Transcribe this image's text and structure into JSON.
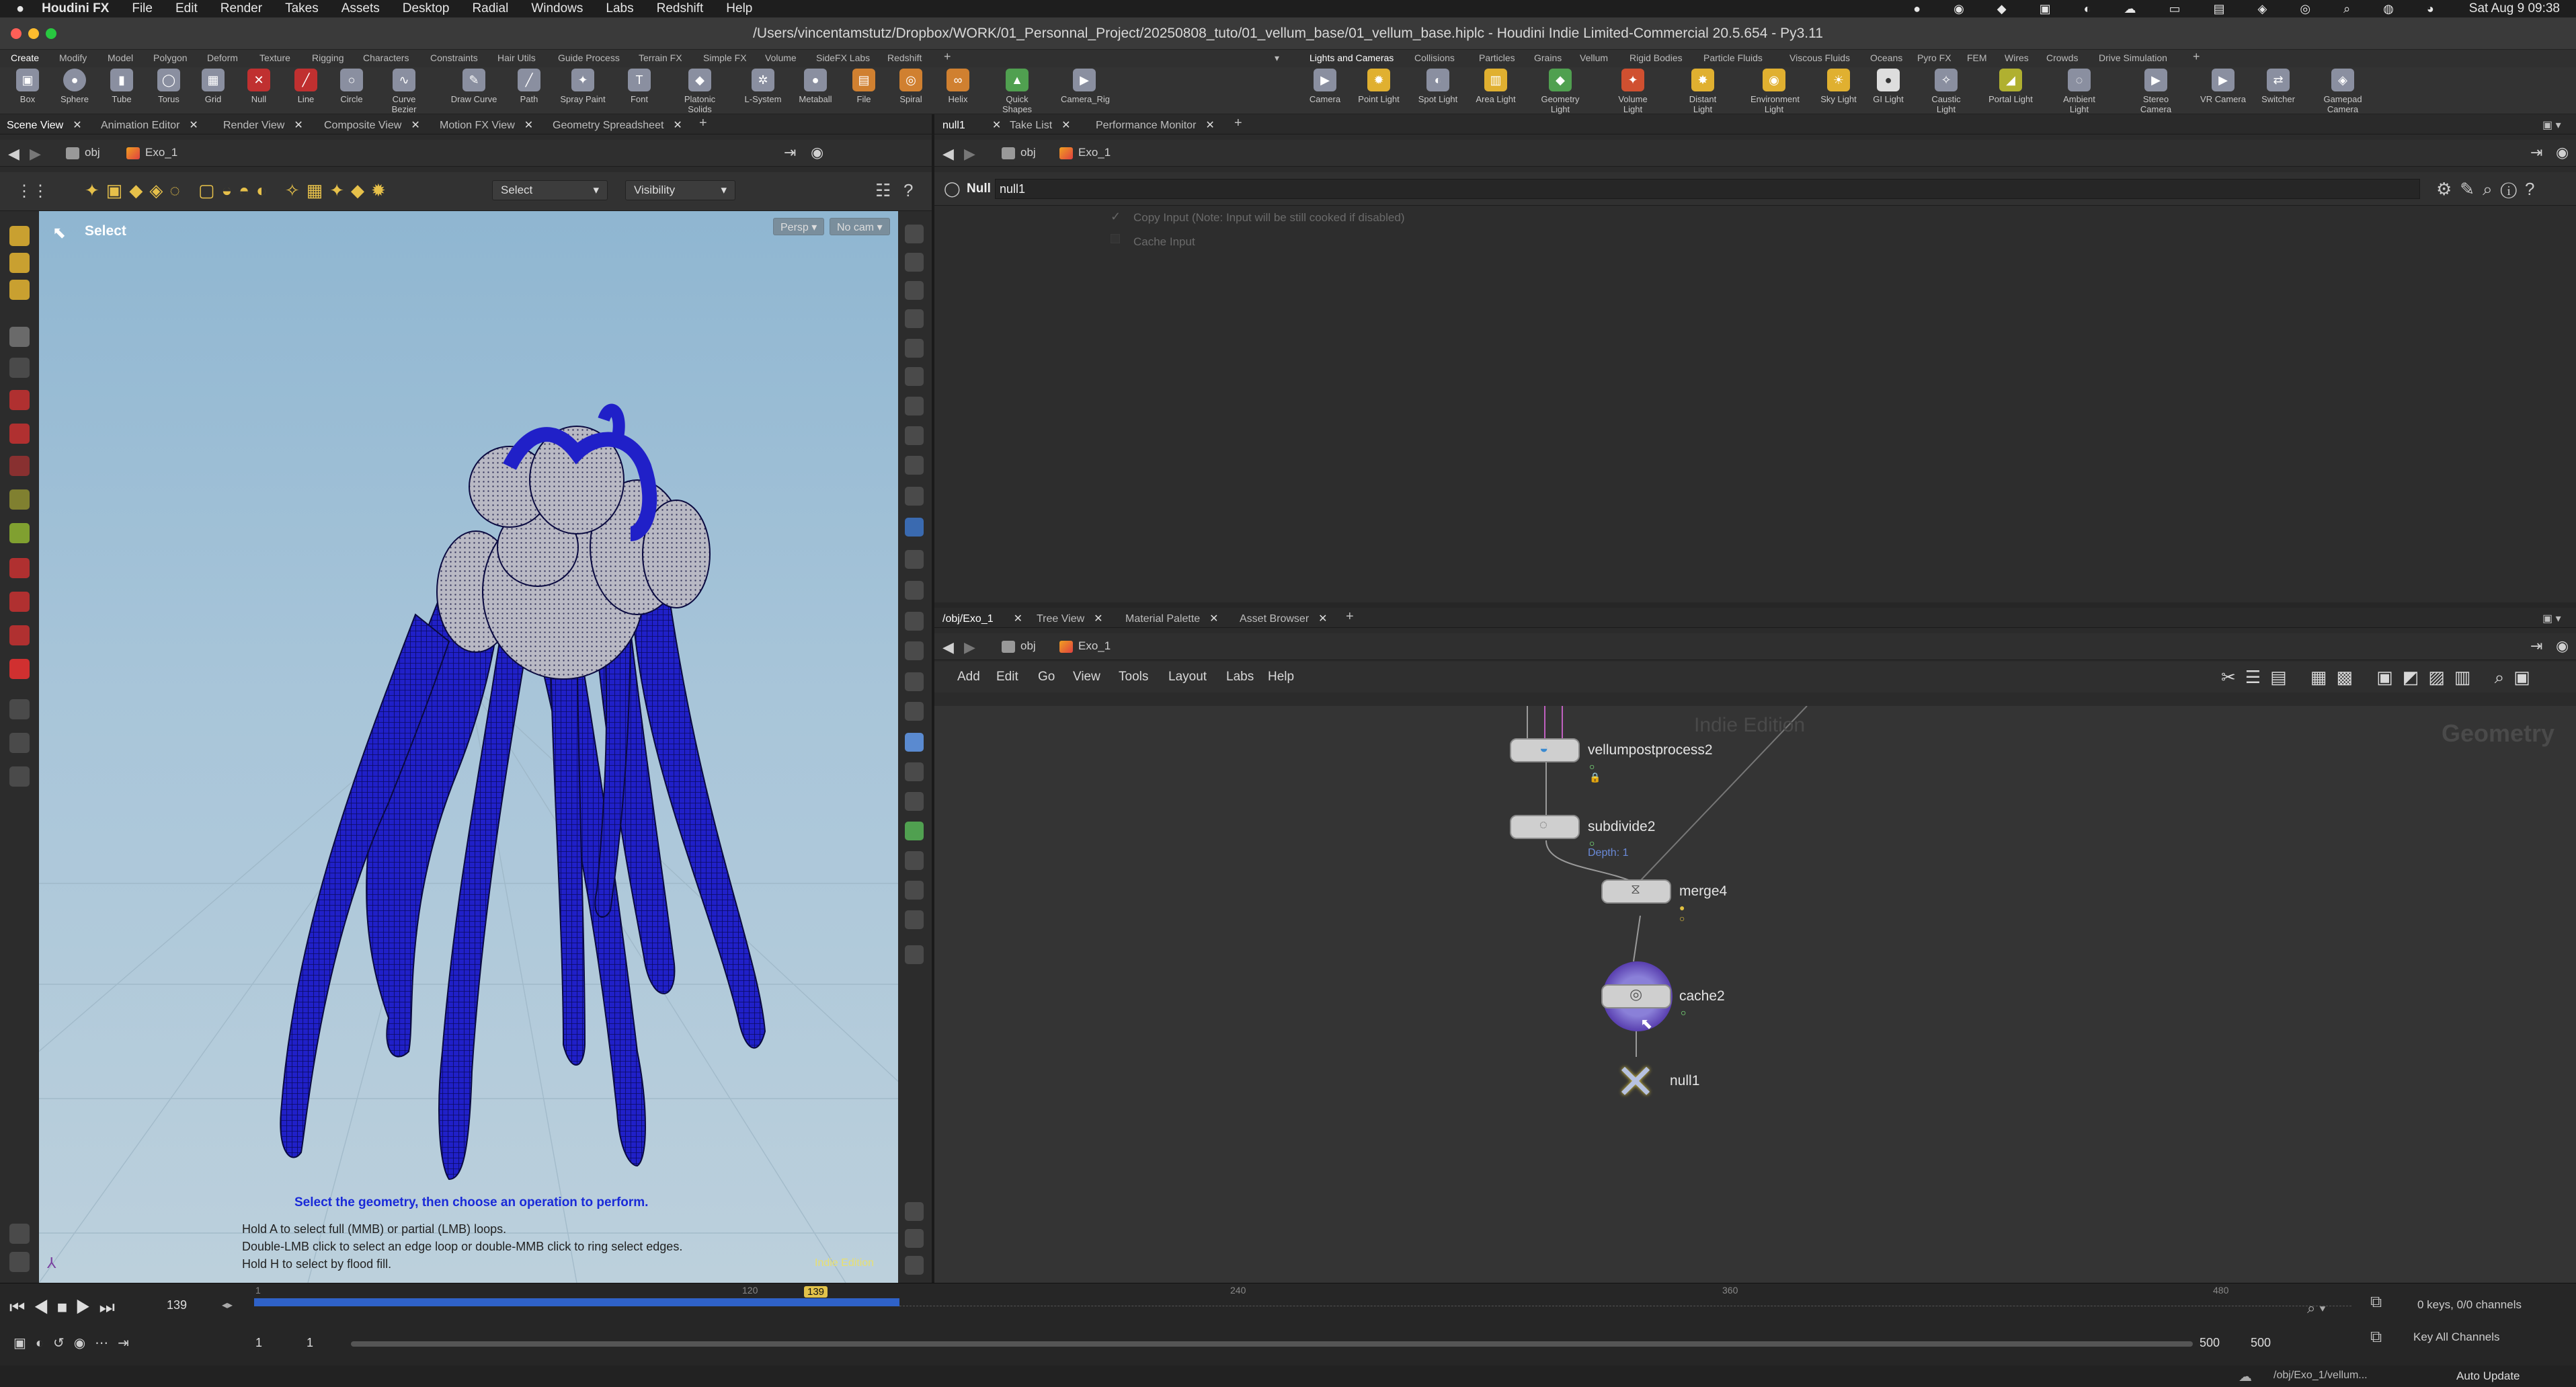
{
  "menubar": {
    "app": "Houdini FX",
    "items": [
      "File",
      "Edit",
      "Render",
      "Takes",
      "Assets",
      "Desktop",
      "Radial",
      "Windows",
      "Labs",
      "Redshift",
      "Help"
    ],
    "clock": "Sat Aug 9  09:38"
  },
  "window": {
    "title": "/Users/vincentamstutz/Dropbox/WORK/01_Personnal_Project/20250808_tuto/01_vellum_base/01_vellum_base.hiplc - Houdini Indie Limited-Commercial 20.5.654 - Py3.11"
  },
  "shelf_tabs_left": [
    "Create",
    "Modify",
    "Model",
    "Polygon",
    "Deform",
    "Texture",
    "Rigging",
    "Characters",
    "Constraints",
    "Hair Utils",
    "Guide Process",
    "Terrain FX",
    "Simple FX",
    "Volume",
    "SideFX Labs",
    "Redshift"
  ],
  "shelf_tabs_right": [
    "Lights and Cameras",
    "Collisions",
    "Particles",
    "Grains",
    "Vellum",
    "Rigid Bodies",
    "Particle Fluids",
    "Viscous Fluids",
    "Oceans",
    "Pyro FX",
    "FEM",
    "Wires",
    "Crowds",
    "Drive Simulation"
  ],
  "shelf_tools_left": [
    "Box",
    "Sphere",
    "Tube",
    "Torus",
    "Grid",
    "Null",
    "Line",
    "Circle",
    "Curve Bezier",
    "Draw Curve",
    "Path",
    "Spray Paint",
    "Font",
    "Platonic Solids",
    "L-System",
    "Metaball",
    "File",
    "Spiral",
    "Helix",
    "Quick Shapes",
    "Camera_Rig"
  ],
  "shelf_tools_right": [
    "Camera",
    "Point Light",
    "Spot Light",
    "Area Light",
    "Geometry Light",
    "Volume Light",
    "Distant Light",
    "Environment Light",
    "Sky Light",
    "GI Light",
    "Caustic Light",
    "Portal Light",
    "Ambient Light",
    "Stereo Camera",
    "VR Camera",
    "Switcher",
    "Gamepad Camera"
  ],
  "left_pane_tabs": [
    "Scene View",
    "Animation Editor",
    "Render View",
    "Composite View",
    "Motion FX View",
    "Geometry Spreadsheet"
  ],
  "top_right_tabs": [
    "null1",
    "Take List",
    "Performance Monitor"
  ],
  "path": {
    "obj": "obj",
    "geo": "Exo_1"
  },
  "viewport": {
    "select_dropdown": "Select",
    "visibility_dropdown": "Visibility",
    "select_label": "Select",
    "persp": "Persp",
    "cam": "No cam",
    "hint_main": "Select the geometry, then choose an operation to perform.",
    "hint_lines": [
      "Hold A to select full (MMB) or partial (LMB) loops.",
      "Double-LMB click to select an edge loop or double-MMB click to ring select edges.",
      "Hold H to select by flood fill."
    ],
    "watermark": "Indie Edition",
    "wire_color": "#1a1ad0"
  },
  "params": {
    "type": "Null",
    "name": "null1",
    "copy_input": "Copy Input (Note: Input will be still cooked if disabled)",
    "cache_input": "Cache Input"
  },
  "net_tabs": [
    "/obj/Exo_1",
    "Tree View",
    "Material Palette",
    "Asset Browser"
  ],
  "net_menu": [
    "Add",
    "Edit",
    "Go",
    "View",
    "Tools",
    "Layout",
    "Labs",
    "Help"
  ],
  "network": {
    "watermark": "Indie Edition",
    "context": "Geometry",
    "nodes": [
      {
        "name": "vellumpostprocess2"
      },
      {
        "name": "subdivide2",
        "sub": "Depth: 1"
      },
      {
        "name": "merge4"
      },
      {
        "name": "cache2"
      },
      {
        "name": "null1"
      }
    ]
  },
  "timeline": {
    "frame": "139",
    "marker": "139",
    "start": "1",
    "start2": "1",
    "end": "500",
    "end2": "500",
    "ticks": [
      "1",
      "120",
      "240",
      "360",
      "480"
    ],
    "keys": "0 keys, 0/0 channels",
    "key_all": "Key All Channels",
    "status_path": "/obj/Exo_1/vellum...",
    "auto_update": "Auto Update"
  }
}
